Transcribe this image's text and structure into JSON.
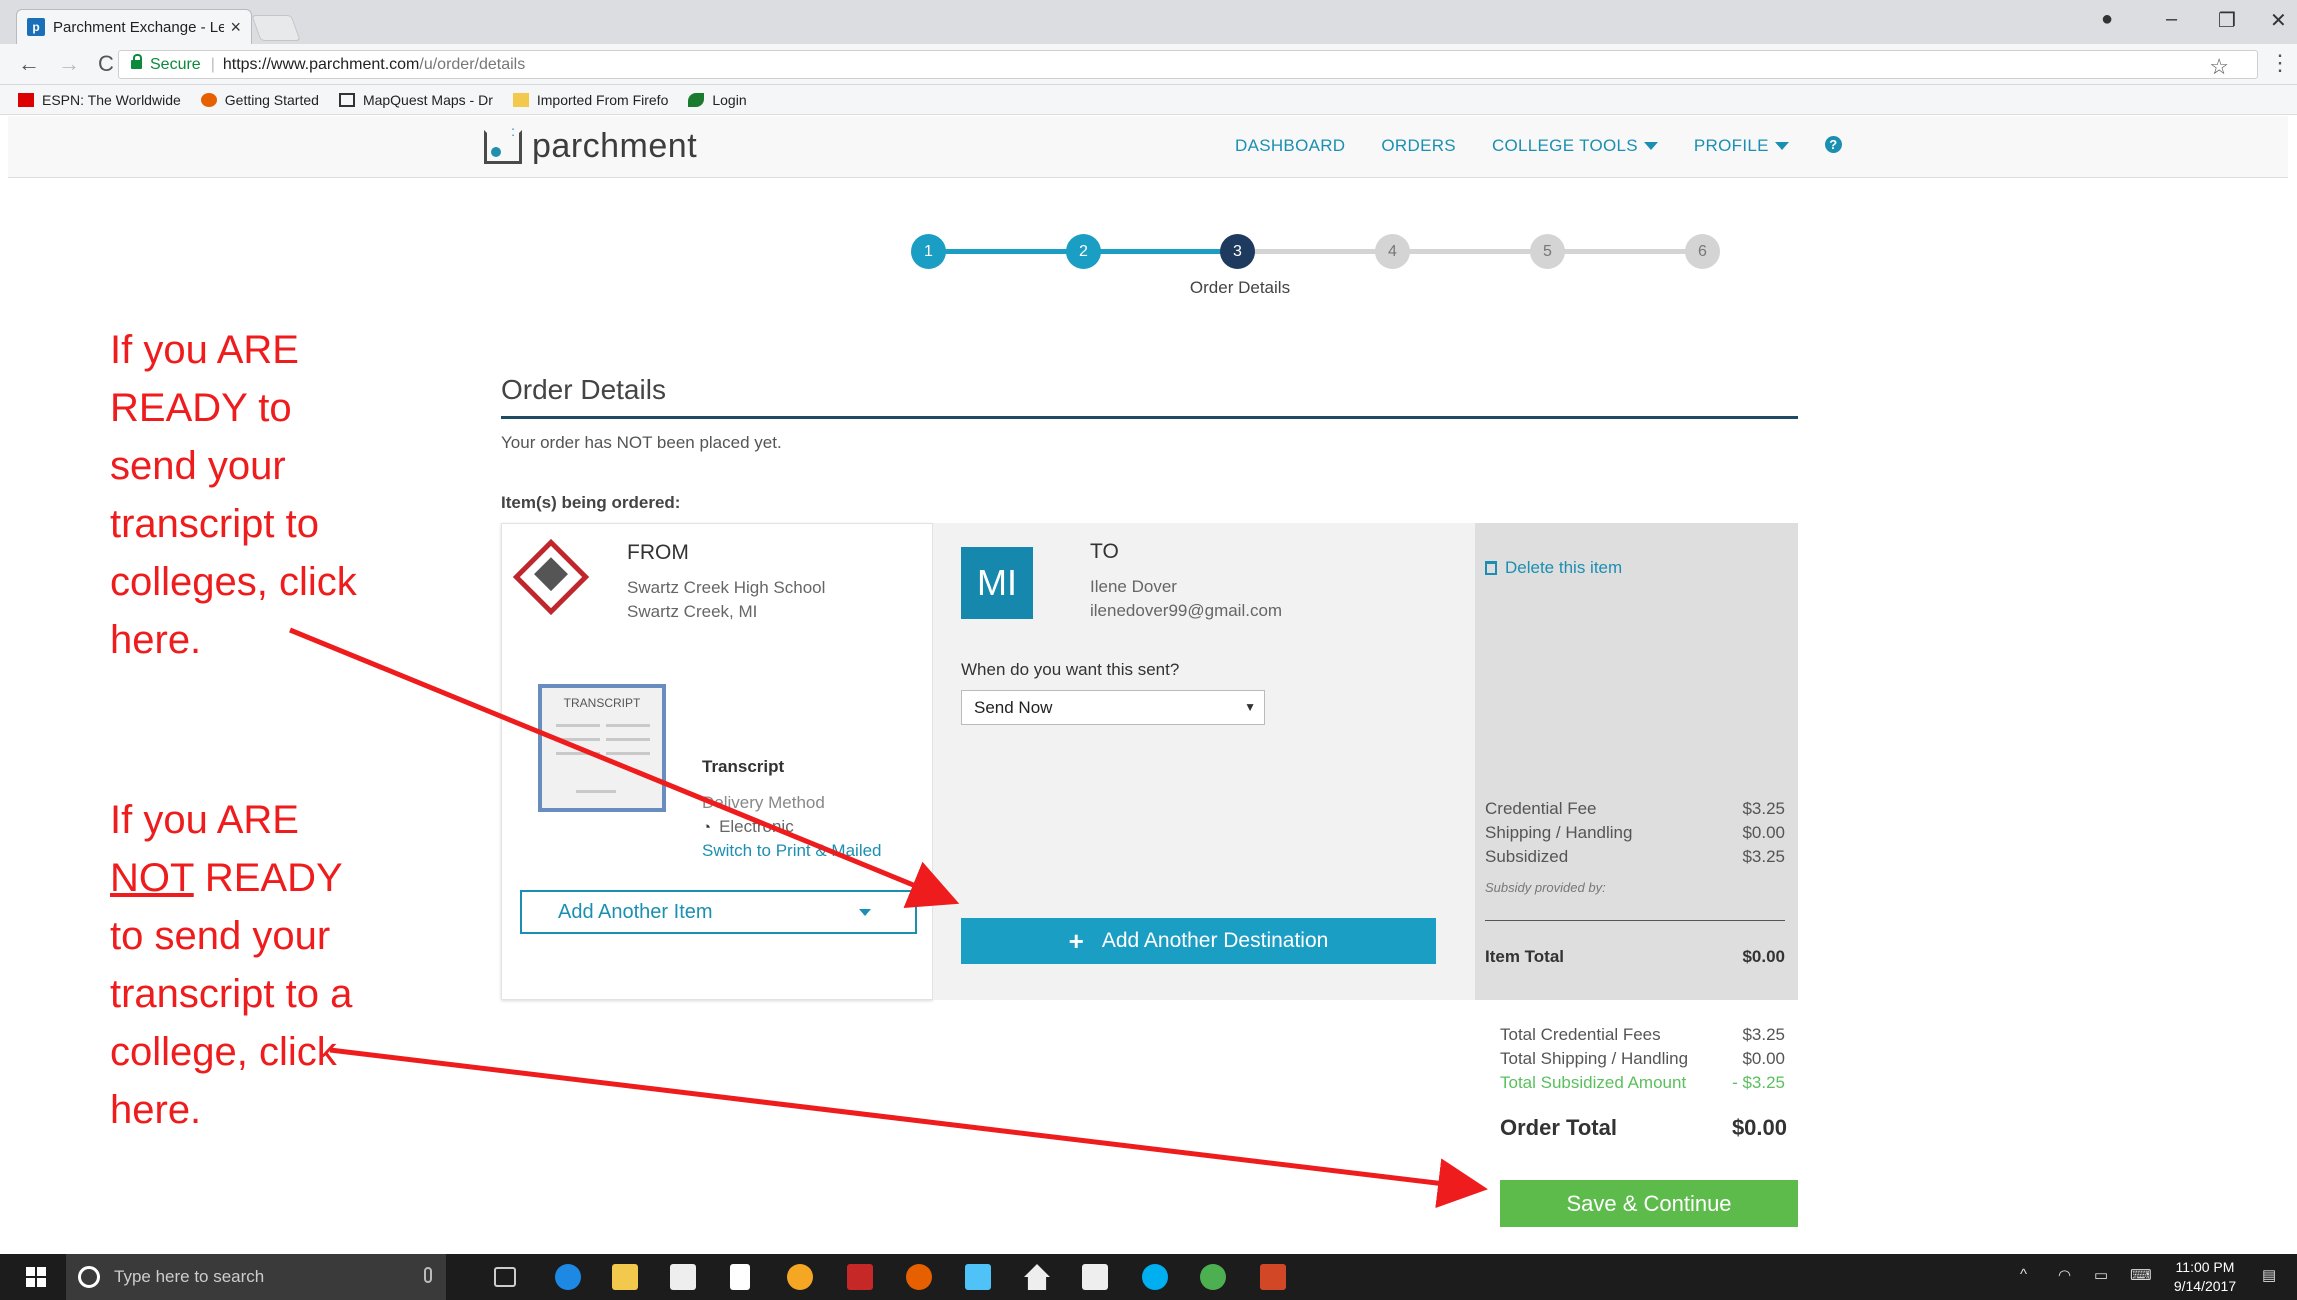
{
  "browser": {
    "tab_title": "Parchment Exchange - Le",
    "tab_favicon": "p",
    "secure_label": "Secure",
    "url_host": "https://www.parchment.com",
    "url_path": "/u/order/details",
    "bookmarks": [
      {
        "label": "ESPN: The Worldwide",
        "icon": "espn-icon"
      },
      {
        "label": "Getting Started",
        "icon": "firefox-icon"
      },
      {
        "label": "MapQuest Maps - Dr",
        "icon": "map-icon"
      },
      {
        "label": "Imported From Firefo",
        "icon": "folder-icon"
      },
      {
        "label": "Login",
        "icon": "leaf-icon"
      }
    ]
  },
  "site": {
    "logo_text": "parchment",
    "nav": {
      "dashboard": "DASHBOARD",
      "orders": "ORDERS",
      "college_tools": "COLLEGE TOOLS",
      "profile": "PROFILE",
      "help": "?"
    }
  },
  "stepper": {
    "steps": [
      "1",
      "2",
      "3",
      "4",
      "5",
      "6"
    ],
    "current": 3,
    "current_label": "Order Details",
    "colors": {
      "done": "#1b9ec4",
      "current": "#1e3a5f",
      "pending": "#d4d4d4"
    }
  },
  "order": {
    "title": "Order Details",
    "note": "Your order has NOT been placed yet.",
    "items_label": "Item(s) being ordered:",
    "from": {
      "heading": "FROM",
      "school": "Swartz Creek High School",
      "location": "Swartz Creek, MI"
    },
    "item": {
      "image_label": "TRANSCRIPT",
      "name": "Transcript",
      "delivery_label": "Delivery Method",
      "delivery_value": "Electronic",
      "switch_link": "Switch to Print & Mailed"
    },
    "add_item_label": "Add Another Item",
    "to": {
      "initials": "MI",
      "heading": "TO",
      "name": "Ilene Dover",
      "email": "ilenedover99@gmail.com"
    },
    "when_label": "When do you want this sent?",
    "when_value": "Send Now",
    "add_destination_label": "Add Another Destination",
    "delete_label": "Delete this item",
    "fees": [
      {
        "label": "Credential Fee",
        "value": "$3.25"
      },
      {
        "label": "Shipping / Handling",
        "value": "$0.00"
      },
      {
        "label": "Subsidized",
        "value": "$3.25"
      }
    ],
    "subsidy_label": "Subsidy provided by:",
    "item_total_label": "Item Total",
    "item_total_value": "$0.00",
    "totals": [
      {
        "label": "Total Credential Fees",
        "value": "$3.25"
      },
      {
        "label": "Total Shipping / Handling",
        "value": "$0.00"
      },
      {
        "label": "Total Subsidized Amount",
        "value": "- $3.25"
      }
    ],
    "order_total_label": "Order Total",
    "order_total_value": "$0.00",
    "save_label": "Save & Continue"
  },
  "annotations": {
    "ready": [
      "If you ARE",
      "READY to",
      "send your",
      "transcript to",
      "colleges, click",
      "here."
    ],
    "not_ready_prefix": "If you ARE",
    "not_ready_underlined": "NOT",
    "not_ready_rest_line": " READY",
    "not_ready_lines": [
      "to send your",
      "transcript to a",
      "college, click",
      "here."
    ],
    "color": "#ee1c1c"
  },
  "taskbar": {
    "search_placeholder": "Type here to search",
    "time": "11:00 PM",
    "date": "9/14/2017"
  }
}
